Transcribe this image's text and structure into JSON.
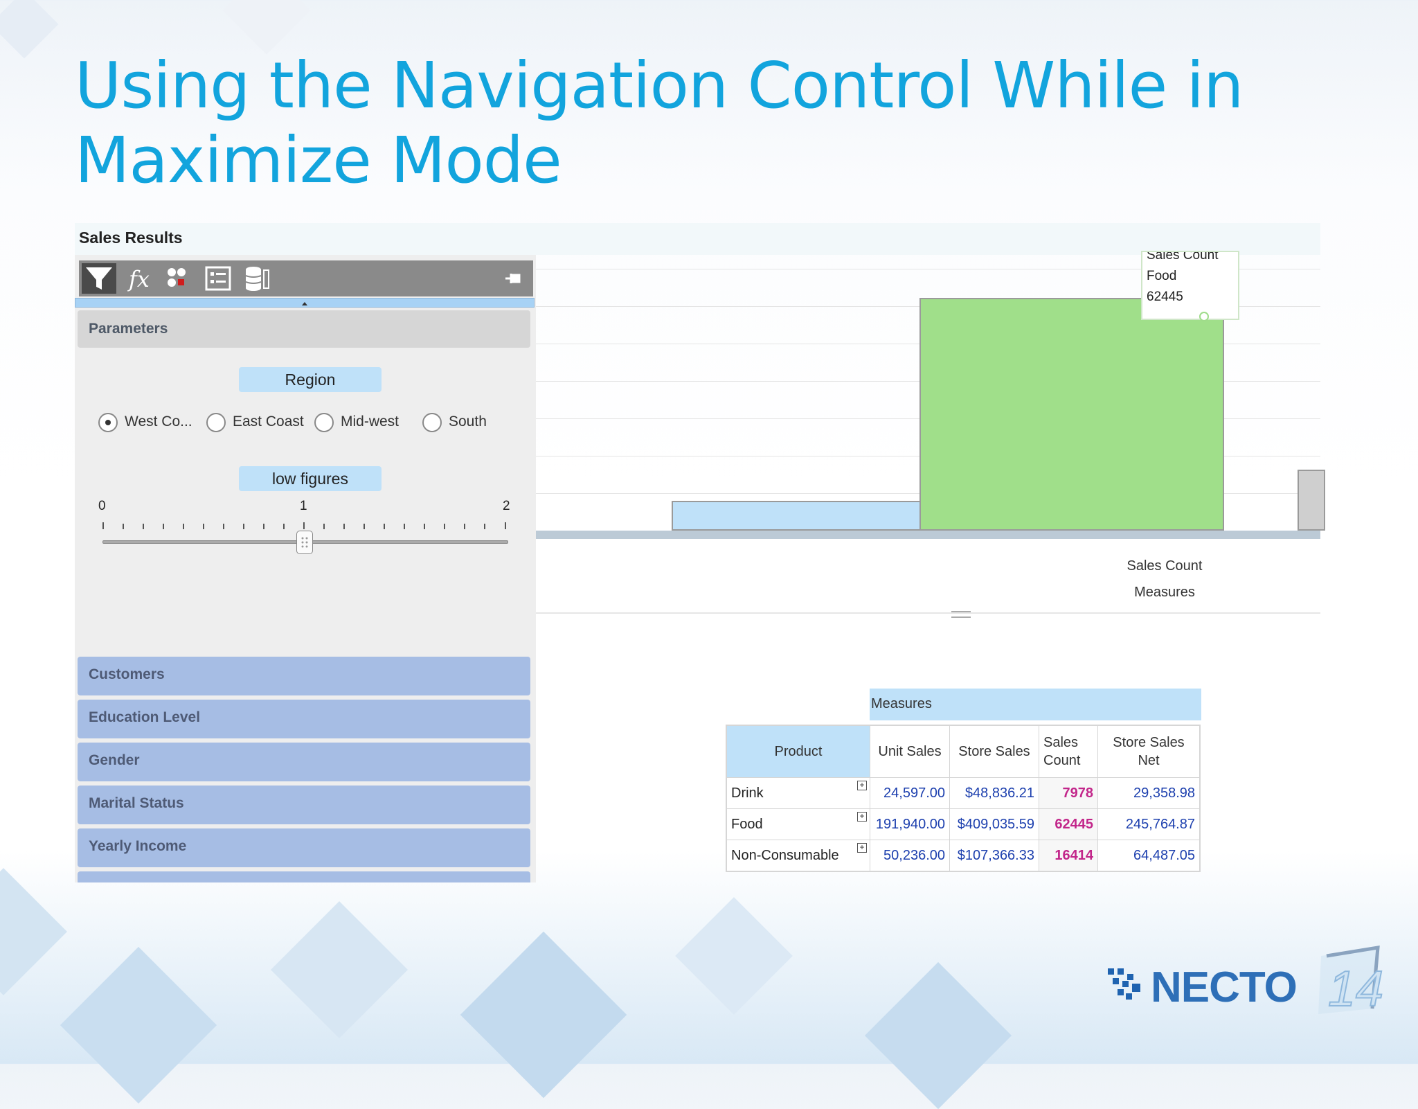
{
  "slide": {
    "title": "Using the Navigation Control While in Maximize Mode"
  },
  "app": {
    "header_title": "Sales Results",
    "toolbar": {
      "icons": [
        "filter-icon",
        "function-icon",
        "groups-icon",
        "list-icon",
        "database-icon",
        "pin-icon"
      ]
    },
    "parameters_label": "Parameters",
    "region_label": "Region",
    "radio_options": [
      {
        "label": "West Co...",
        "selected": true
      },
      {
        "label": "East Coast",
        "selected": false
      },
      {
        "label": "Mid-west",
        "selected": false
      },
      {
        "label": "South",
        "selected": false
      }
    ],
    "slider": {
      "label": "low figures",
      "min_label": "0",
      "mid_label": "1",
      "max_label": "2",
      "value": 1
    },
    "nav_items": [
      "Customers",
      "Education Level",
      "Gender",
      "Marital Status",
      "Yearly Income"
    ]
  },
  "chart_data": {
    "type": "bar",
    "tooltip": {
      "line1": "Sales Count",
      "line2": "Food",
      "line3": "62445"
    },
    "series": [
      {
        "category": "Drink",
        "value": 7978,
        "color": "#bfe1f9"
      },
      {
        "category": "Food",
        "value": 62445,
        "color": "#a0df8a"
      },
      {
        "category": "Non-Consumable",
        "value": 16414,
        "color": "#cfcfcf"
      }
    ],
    "xlabel_line1": "Sales Count",
    "xlabel_line2": "Measures"
  },
  "table": {
    "measures_label": "Measures",
    "columns": [
      "Product",
      "Unit Sales",
      "Store Sales",
      "Sales Count",
      "Store Sales Net"
    ],
    "rows": [
      {
        "product": "Drink",
        "unit_sales": "24,597.00",
        "store_sales": "$48,836.21",
        "sales_count": "7978",
        "store_sales_net": "29,358.98"
      },
      {
        "product": "Food",
        "unit_sales": "191,940.00",
        "store_sales": "$409,035.59",
        "sales_count": "62445",
        "store_sales_net": "245,764.87"
      },
      {
        "product": "Non-Consumable",
        "unit_sales": "50,236.00",
        "store_sales": "$107,366.33",
        "sales_count": "16414",
        "store_sales_net": "64,487.05"
      }
    ]
  },
  "logo": {
    "text": "NECTO",
    "version": "14"
  },
  "colors": {
    "title": "#12a4dd",
    "count_text": "#c2268a",
    "value_text": "#1c3fae",
    "nav_item": "#a6bde4"
  }
}
